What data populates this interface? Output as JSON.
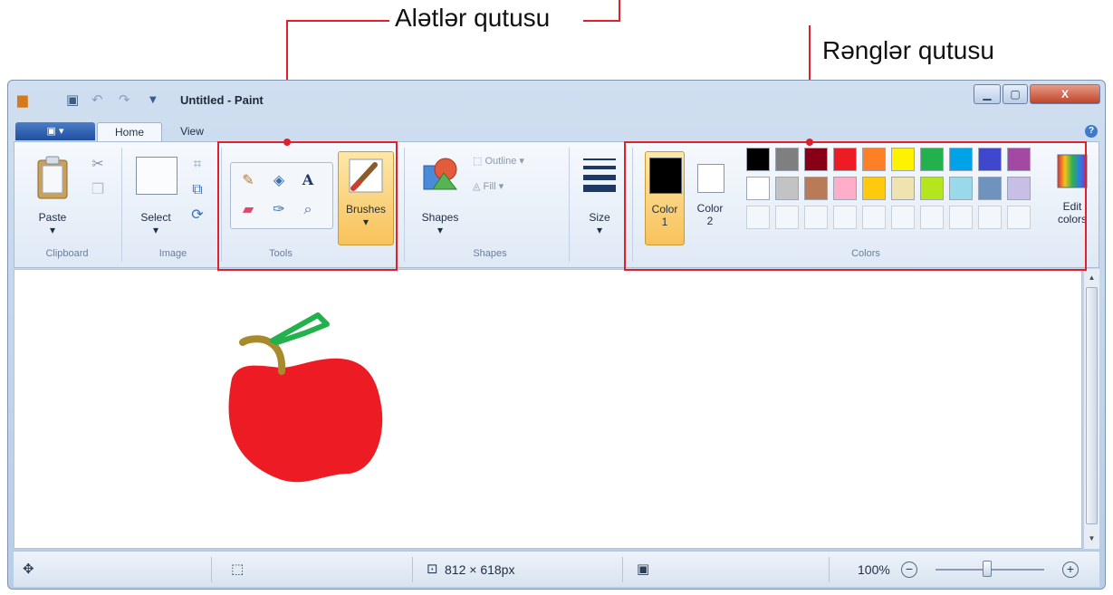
{
  "annotations": {
    "tools_box_label": "Alətlər qutusu",
    "colors_box_label": "Rənglər qutusu"
  },
  "titlebar": {
    "title": "Untitled - Paint",
    "quick_access": [
      "paint-icon",
      "save-icon",
      "undo-icon",
      "redo-icon",
      "customize-icon"
    ]
  },
  "tabs": {
    "file_glyph": "▣ ▾",
    "home": "Home",
    "view": "View"
  },
  "ribbon": {
    "clipboard": {
      "label": "Clipboard",
      "paste": "Paste"
    },
    "image": {
      "label": "Image",
      "select": "Select"
    },
    "tools": {
      "label": "Tools",
      "brushes": "Brushes"
    },
    "shapes": {
      "label": "Shapes",
      "shapes": "Shapes",
      "outline": "Outline ▾",
      "fill": "Fill ▾"
    },
    "size": {
      "label": "Size"
    },
    "colors": {
      "label": "Colors",
      "color1": "Color",
      "color1_num": "1",
      "color2": "Color",
      "color2_num": "2",
      "edit": "Edit",
      "edit2": "colors",
      "color1_value": "#000000",
      "color2_value": "#ffffff",
      "palette_row1": [
        "#000000",
        "#7f7f7f",
        "#880015",
        "#ed1c24",
        "#ff7f27",
        "#fff200",
        "#22b14c",
        "#00a2e8",
        "#3f48cc",
        "#a349a4"
      ],
      "palette_row2": [
        "#ffffff",
        "#c3c3c3",
        "#b97a57",
        "#ffaec9",
        "#ffc90e",
        "#efe4b0",
        "#b5e61d",
        "#99d9ea",
        "#7092be",
        "#c8bfe7"
      ]
    }
  },
  "status": {
    "dimensions": "812 × 618px",
    "zoom": "100%"
  },
  "canvas": {
    "apple_color": "#ed1c24",
    "stem_color": "#a88a2a",
    "leaf_color": "#22b14c"
  }
}
